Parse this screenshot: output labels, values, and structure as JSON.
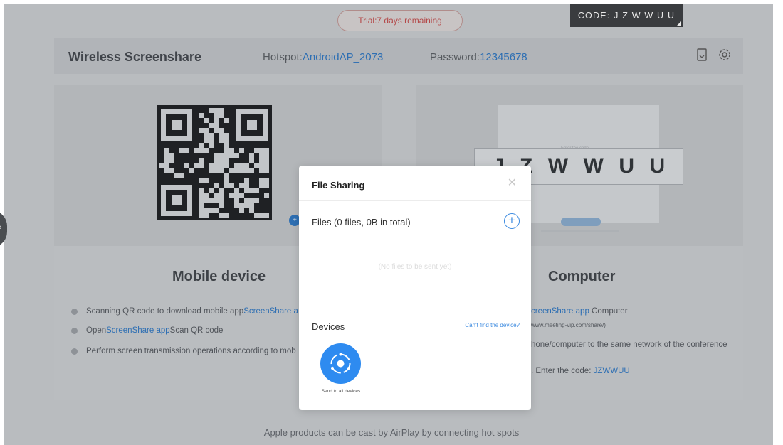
{
  "banner": {
    "trial_text": "Trial:7 days remaining",
    "code_text": "CODE: J Z W W U U"
  },
  "header": {
    "title": "Wireless Screenshare",
    "hotspot_label": "Hotspot:",
    "hotspot_value": "AndroidAP_2073",
    "password_label": "Password:",
    "password_value": "12345678",
    "icons": [
      "file-icon",
      "gear-icon"
    ]
  },
  "mobile": {
    "heading": "Mobile device",
    "steps": [
      {
        "pre": "Scanning QR code to download mobile app ",
        "link": "ScreenShare a",
        "post": ""
      },
      {
        "pre": "Open ",
        "link": "ScreenShare app",
        "post": " Scan QR code"
      },
      {
        "pre": "Perform screen transmission operations according to mob",
        "link": "",
        "post": ""
      }
    ]
  },
  "computer": {
    "heading": "Computer",
    "demo_heading": "Enter the code",
    "code_letters": [
      "J",
      "Z",
      "W",
      "W",
      "U",
      "U"
    ],
    "steps": [
      {
        "pre": "",
        "link": "creenShare app",
        "post": " Computer"
      },
      {
        "pre": "www.meeting-vip.com/share/)",
        "link": "",
        "post": ""
      },
      {
        "pre": "hone/computer to the same network of the conference",
        "link": "",
        "post": ""
      },
      {
        "pre": ". Enter the code: ",
        "link": "JZWWUU",
        "post": ""
      }
    ]
  },
  "footer": {
    "note": "Apple products can be cast by AirPlay by connecting hot spots"
  },
  "dialog": {
    "title": "File Sharing",
    "close_icon": "close-icon",
    "files_label": "Files (0 files, 0B in total)",
    "add_icon": "plus-circle-icon",
    "empty_text": "(No files to be sent yet)",
    "devices_label": "Devices",
    "cant_find": "Can't find the device?",
    "device_caption": "Send to all devices"
  },
  "colors": {
    "accent_blue": "#2e8bf0",
    "link_blue": "#2e6fb3",
    "trial_red": "#b44848",
    "overlay_gray": "#b9bcbf"
  }
}
